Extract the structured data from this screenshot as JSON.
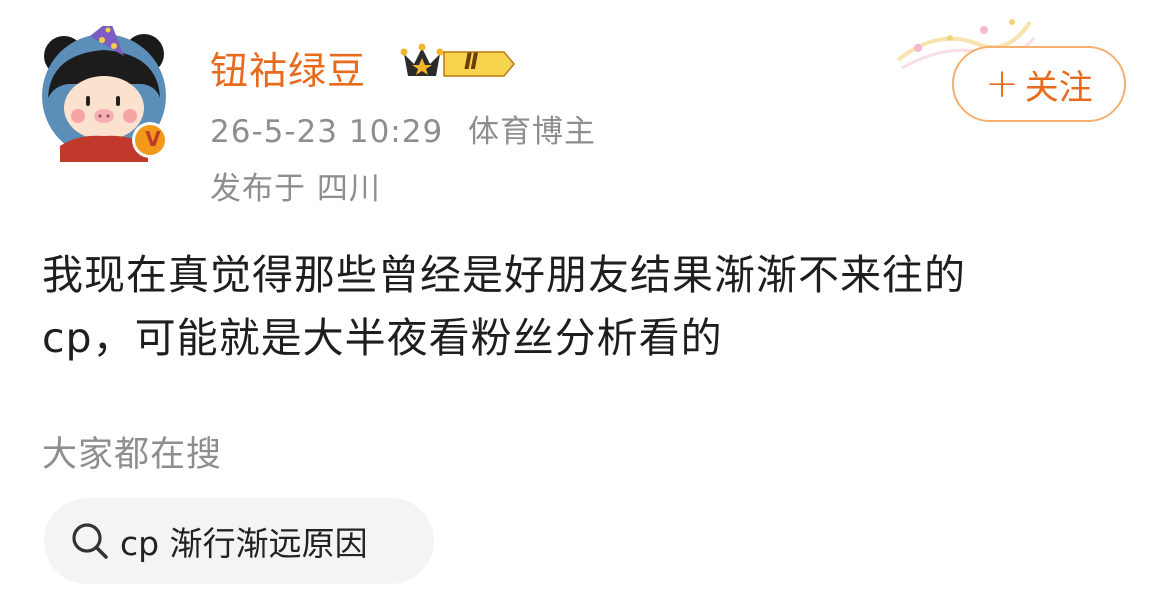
{
  "user": {
    "name": "钮祜绿豆",
    "level_badge": "Ⅱ",
    "avatar_badge": "V"
  },
  "post": {
    "timestamp": "26-5-23 10:29",
    "user_tag": "体育博主",
    "location": "发布于 四川",
    "content_line1": "我现在真觉得那些曾经是好朋友结果渐渐不来往的",
    "content_line2": "cp，可能就是大半夜看粉丝分析看的"
  },
  "follow": {
    "plus": "+",
    "label": "关注"
  },
  "search": {
    "section_label": "大家都在搜",
    "query": "cp 渐行渐远原因"
  },
  "colors": {
    "accent": "#e86a1c",
    "follow_border": "#f3b071",
    "muted_text": "#8e8e8e",
    "chip_bg": "#f4f4f4"
  }
}
